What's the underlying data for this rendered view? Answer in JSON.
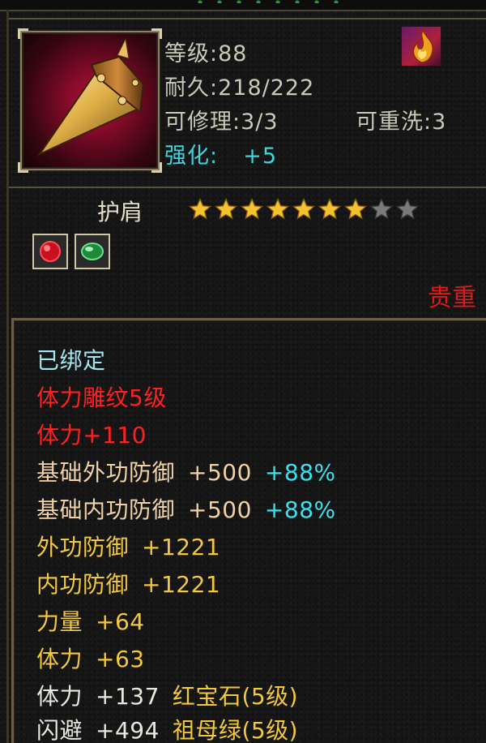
{
  "header": {
    "level": "等级:88",
    "durability": "耐久:218/222",
    "repairable": "可修理:3/3",
    "rewash": "可重洗:3",
    "enhance_label": "强化:",
    "enhance_value": "+5"
  },
  "item": {
    "name": "护肩",
    "stars_total": 9,
    "stars_filled": 7,
    "gem_slots": [
      "ruby",
      "emerald"
    ],
    "rarity": "贵重"
  },
  "colors": {
    "red": "#ff2020",
    "cyan": "#3fd3dc",
    "yellow": "#f2c83c",
    "tan": "#f0d2a6"
  },
  "attributes": {
    "bound": "已绑定",
    "engrave": "体力雕纹5级",
    "engrave_stat": "体力+110",
    "base_ext_def_label": "基础外功防御",
    "base_ext_def_value": "+500",
    "base_ext_def_pct": "+88%",
    "base_int_def_label": "基础内功防御",
    "base_int_def_value": "+500",
    "base_int_def_pct": "+88%",
    "ext_def_label": "外功防御",
    "ext_def_value": "+1221",
    "int_def_label": "内功防御",
    "int_def_value": "+1221",
    "str_label": "力量",
    "str_value": "+64",
    "vit_label": "体力",
    "vit_value": "+63",
    "gem1_stat_label": "体力",
    "gem1_stat_value": "+137",
    "gem1_name": "红宝石",
    "gem1_level": "(5级)",
    "gem2_stat_label": "闪避",
    "gem2_stat_value": "+494",
    "gem2_name": "祖母绿",
    "gem2_level": "(5级)"
  }
}
